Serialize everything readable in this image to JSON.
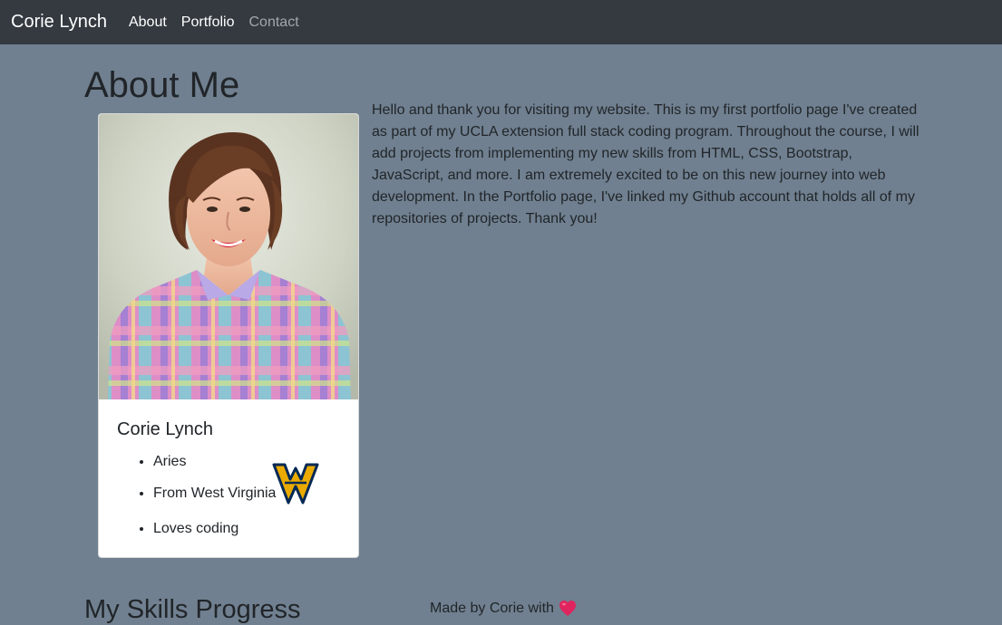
{
  "navbar": {
    "brand": "Corie Lynch",
    "links": [
      {
        "label": "About",
        "active": true
      },
      {
        "label": "Portfolio",
        "active": true
      },
      {
        "label": "Contact",
        "active": false
      }
    ],
    "background": "#343a40"
  },
  "page": {
    "background": "#708090"
  },
  "about": {
    "title": "About Me",
    "intro": "Hello and thank you for visiting my website. This is my first portfolio page I've created as part of my UCLA extension full stack coding program. Throughout the course, I will add projects from implementing my new skills from HTML, CSS, Bootstrap, JavaScript, and more. I am extremely excited to be on this new journey into web development. In the Portfolio page, I've linked my Github account that holds all of my repositories of projects. Thank you!"
  },
  "card": {
    "photo_icon": "profile-photo",
    "name": "Corie Lynch",
    "facts": [
      "Aries",
      "From West Virginia",
      "Loves coding"
    ],
    "logo_icon": "west-virginia-wv-logo",
    "logo_colors": {
      "gold": "#EAAA00",
      "navy": "#002855"
    }
  },
  "skills": {
    "title": "My Skills Progress"
  },
  "footer": {
    "made_by": "Made by Corie with",
    "heart_icon": "heart-icon",
    "heart_color": "#e0245e"
  }
}
